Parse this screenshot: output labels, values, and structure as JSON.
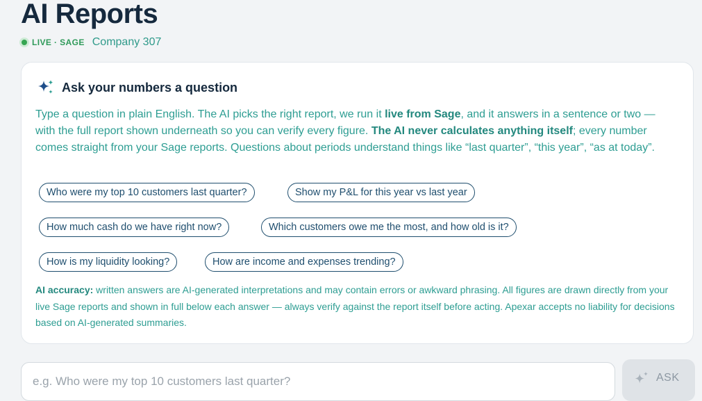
{
  "page": {
    "title": "AI Reports",
    "status": "LIVE · SAGE",
    "company": "Company 307"
  },
  "card": {
    "title": "Ask your numbers a question",
    "intro": {
      "p1": "Type a question in plain English. The AI picks the right report, we run it ",
      "b1": "live from Sage",
      "p2": ", and it answers in a sentence or two — with the full report shown underneath so you can verify every figure. ",
      "b2": "The AI never calculates anything itself",
      "p3": "; every number comes straight from your Sage reports. Questions about periods understand things like “last quarter”, “this year”, “as at today”."
    },
    "suggestions": [
      "Who were my top 10 customers last quarter?",
      "Show my P&L for this year vs last year",
      "How much cash do we have right now?",
      "Which customers owe me the most, and how old is it?",
      "How is my liquidity looking?",
      "How are income and expenses trending?"
    ],
    "disclaimer": {
      "label": "AI accuracy:",
      "text": " written answers are AI-generated interpretations and may contain errors or awkward phrasing. All figures are drawn directly from your live Sage reports and shown in full below each answer — always verify against the report itself before acting. Apexar accepts no liability for decisions based on AI-generated summaries."
    }
  },
  "input": {
    "placeholder": "e.g. Who were my top 10 customers last quarter?",
    "value": ""
  },
  "ask_button": {
    "label": "ASK",
    "icon": "sparkle-icon"
  },
  "colors": {
    "title": "#15293d",
    "accent_teal": "#2d9d92",
    "live_green": "#35a552",
    "chip_border": "#1f4e6e",
    "background": "#f2f4f6"
  }
}
